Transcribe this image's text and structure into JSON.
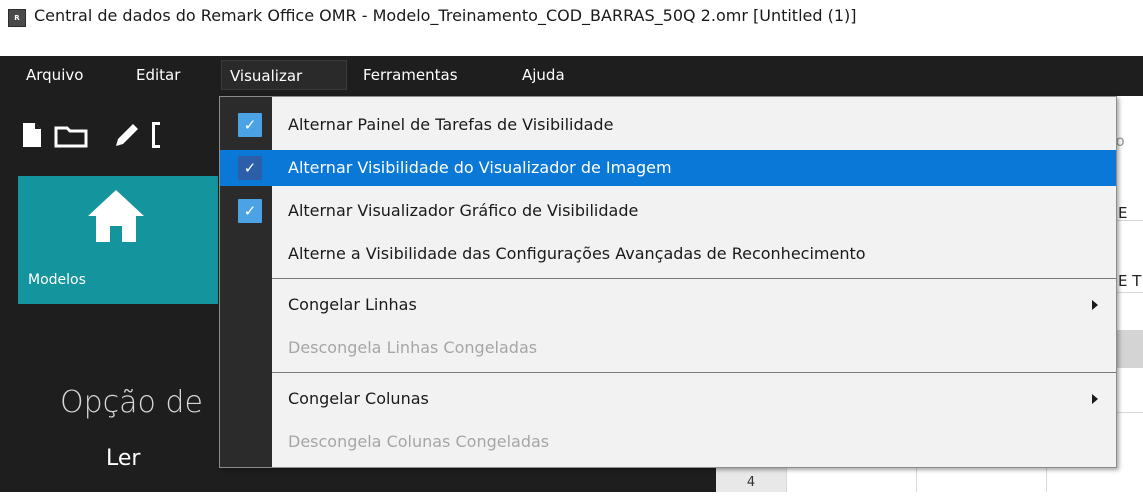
{
  "window": {
    "title": "Central de dados do Remark Office OMR - Modelo_Treinamento_COD_BARRAS_50Q 2.omr [Untitled (1)]",
    "app_icon_text": "R"
  },
  "menubar": {
    "items": [
      {
        "label": "Arquivo"
      },
      {
        "label": "Editar"
      },
      {
        "label": "Visualizar"
      },
      {
        "label": "Ferramentas"
      },
      {
        "label": "Ajuda"
      }
    ]
  },
  "toolbar": {
    "icons": [
      "new-file-icon",
      "open-folder-icon",
      "edit-pencil-icon"
    ]
  },
  "tile": {
    "label": "Modelos",
    "icon": "home-icon",
    "color": "#14949c"
  },
  "left_panel": {
    "heading": "Opção de",
    "item": "Ler"
  },
  "background_fragments": {
    "top_right": "ção",
    "col_a": "E",
    "col_b": "E T",
    "row_number": "4"
  },
  "dropdown": {
    "items": [
      {
        "label": "Alternar Painel de Tarefas de Visibilidade",
        "checked": true,
        "state": "normal"
      },
      {
        "label": "Alternar Visibilidade do Visualizador de Imagem",
        "checked": true,
        "state": "highlighted"
      },
      {
        "label": "Alternar Visualizador Gráfico de Visibilidade",
        "checked": true,
        "state": "normal"
      },
      {
        "label": "Alterne a Visibilidade das Configurações Avançadas de Reconhecimento",
        "checked": false,
        "state": "normal"
      },
      {
        "label": "Congelar Linhas",
        "submenu": true,
        "state": "normal"
      },
      {
        "label": "Descongela Linhas Congeladas",
        "state": "disabled"
      },
      {
        "label": "Congelar Colunas",
        "submenu": true,
        "state": "normal"
      },
      {
        "label": "Descongela Colunas Congeladas",
        "state": "disabled"
      }
    ],
    "highlight_color": "#0a78d7",
    "check_color": "#4ba3e6"
  }
}
